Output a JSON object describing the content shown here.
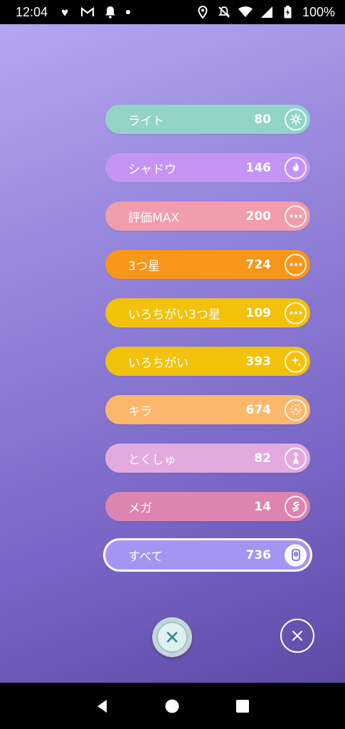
{
  "status_bar": {
    "time": "12:04",
    "battery": "100%",
    "icons_left": [
      "heart-icon",
      "gmail-icon",
      "bell-icon",
      "dot-icon"
    ],
    "icons_right": [
      "location-icon",
      "mute-icon",
      "wifi-icon",
      "signal-icon",
      "battery-icon"
    ]
  },
  "filters": [
    {
      "id": "light",
      "label": "ライト",
      "count": "80",
      "color": "#93d3c8",
      "icon": "light-icon"
    },
    {
      "id": "shadow",
      "label": "シャドウ",
      "count": "146",
      "color": "#c494f4",
      "icon": "shadow-flame-icon"
    },
    {
      "id": "max",
      "label": "評価MAX",
      "count": "200",
      "color": "#f29dac",
      "icon": "three-stars-icon"
    },
    {
      "id": "three-star",
      "label": "3つ星",
      "count": "724",
      "color": "#f6961a",
      "icon": "three-stars-icon"
    },
    {
      "id": "shiny-three-star",
      "label": "いろちがい3つ星",
      "count": "109",
      "color": "#f2c109",
      "icon": "three-stars-icon"
    },
    {
      "id": "shiny",
      "label": "いろちがい",
      "count": "393",
      "color": "#f2c109",
      "icon": "sparkle-icon"
    },
    {
      "id": "lucky",
      "label": "キラ",
      "count": "674",
      "color": "#fbb86c",
      "icon": "lucky-icon"
    },
    {
      "id": "special",
      "label": "とくしゅ",
      "count": "82",
      "color": "#e3aadf",
      "icon": "special-icon"
    },
    {
      "id": "mega",
      "label": "メガ",
      "count": "14",
      "color": "#dd84b0",
      "icon": "mega-icon"
    },
    {
      "id": "all",
      "label": "すべて",
      "count": "736",
      "color": "#a595f2",
      "icon": "all-icon",
      "selected": true
    }
  ],
  "controls": {
    "close_main_icon": "close-icon",
    "close_secondary_icon": "close-icon"
  },
  "nav": {
    "icons": [
      "back-icon",
      "home-icon",
      "recents-icon"
    ]
  },
  "colors": {
    "bg_top": "#b5a6f2",
    "bg_bottom": "#5e4aa6",
    "close_main": "#c3d6d8"
  }
}
